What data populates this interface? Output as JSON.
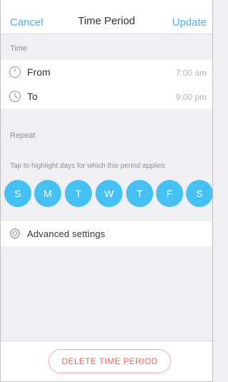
{
  "navbar": {
    "cancel_label": "Cancel",
    "title": "Time Period",
    "update_label": "Update"
  },
  "time_section": {
    "header": "Time",
    "rows": [
      {
        "label": "From",
        "value": "7:00 am",
        "icon": "clock-icon"
      },
      {
        "label": "To",
        "value": "9:00 pm",
        "icon": "clock-icon"
      }
    ]
  },
  "repeat_section": {
    "header": "Repeat",
    "hint": "Tap to highlight days for which this period applies",
    "days": [
      "S",
      "M",
      "T",
      "W",
      "T",
      "F",
      "S"
    ],
    "day_color": "#44c1f2"
  },
  "advanced": {
    "label": "Advanced settings",
    "icon": "gear-icon"
  },
  "footer": {
    "delete_label": "DELETE TIME PERIOD",
    "delete_color": "#e8675c"
  },
  "colors": {
    "accent": "#44b4ee",
    "background": "#efeff4"
  }
}
